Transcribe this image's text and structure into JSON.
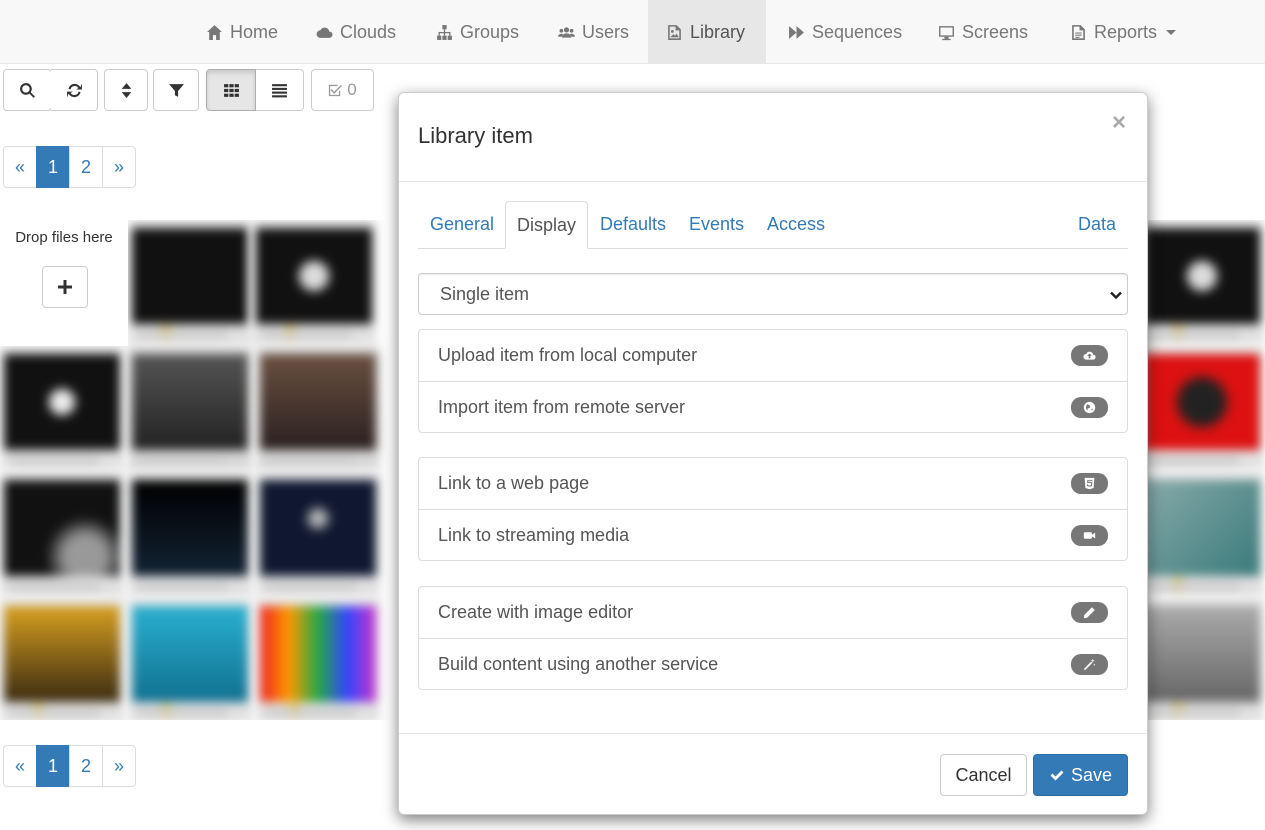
{
  "nav": {
    "items": [
      {
        "label": "Home",
        "icon": "home-icon"
      },
      {
        "label": "Clouds",
        "icon": "cloud-icon"
      },
      {
        "label": "Groups",
        "icon": "sitemap-icon"
      },
      {
        "label": "Users",
        "icon": "users-icon"
      },
      {
        "label": "Library",
        "icon": "file-image-icon",
        "active": true
      },
      {
        "label": "Sequences",
        "icon": "fast-forward-icon"
      },
      {
        "label": "Screens",
        "icon": "desktop-icon"
      },
      {
        "label": "Reports",
        "icon": "file-text-icon",
        "dropdown": true
      }
    ]
  },
  "toolbar": {
    "selected_count": "0"
  },
  "pagination": {
    "prev": "«",
    "pages": [
      "1",
      "2"
    ],
    "next": "»",
    "current": "1"
  },
  "dropzone": {
    "label": "Drop files here"
  },
  "modal": {
    "title": "Library item",
    "close": "×",
    "tabs": [
      "General",
      "Display",
      "Defaults",
      "Events",
      "Access",
      "Data"
    ],
    "active_tab": "Display",
    "select_value": "Single item",
    "groups": [
      [
        {
          "label": "Upload item from local computer",
          "icon": "cloud-upload-icon"
        },
        {
          "label": "Import item from remote server",
          "icon": "globe-icon"
        }
      ],
      [
        {
          "label": "Link to a web page",
          "icon": "html5-icon"
        },
        {
          "label": "Link to streaming media",
          "icon": "video-camera-icon"
        }
      ],
      [
        {
          "label": "Create with image editor",
          "icon": "pencil-icon"
        },
        {
          "label": "Build content using another service",
          "icon": "magic-wand-icon"
        }
      ]
    ],
    "cancel_label": "Cancel",
    "save_label": "Save"
  },
  "colors": {
    "primary": "#337ab7",
    "badge": "#777777",
    "nav_bg": "#f8f8f8",
    "nav_active_bg": "#e7e7e7"
  }
}
